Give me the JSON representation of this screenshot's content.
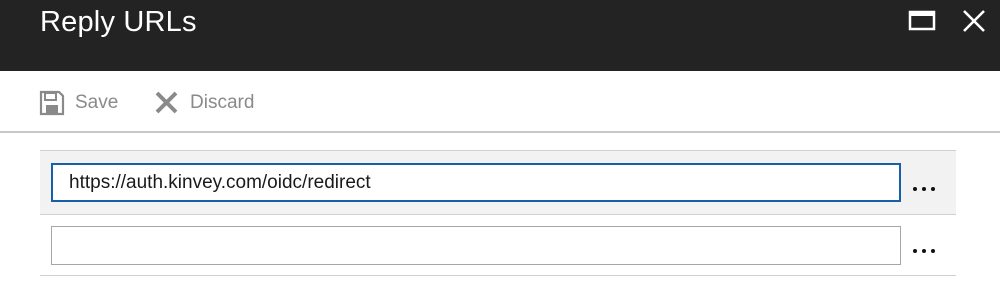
{
  "window": {
    "title": "Reply URLs",
    "maximize_icon": "maximize-icon",
    "close_icon": "close-icon"
  },
  "toolbar": {
    "save_label": "Save",
    "save_icon": "save-icon",
    "discard_label": "Discard",
    "discard_icon": "discard-icon"
  },
  "reply_urls": [
    {
      "value": "https://auth.kinvey.com/oidc/redirect",
      "placeholder": ""
    },
    {
      "value": "",
      "placeholder": ""
    }
  ],
  "row_menu_icon": "more-options-icon",
  "colors": {
    "titlebar": "#232323",
    "focused_border": "#1560a8",
    "disabled_text": "#8a8a8a"
  }
}
